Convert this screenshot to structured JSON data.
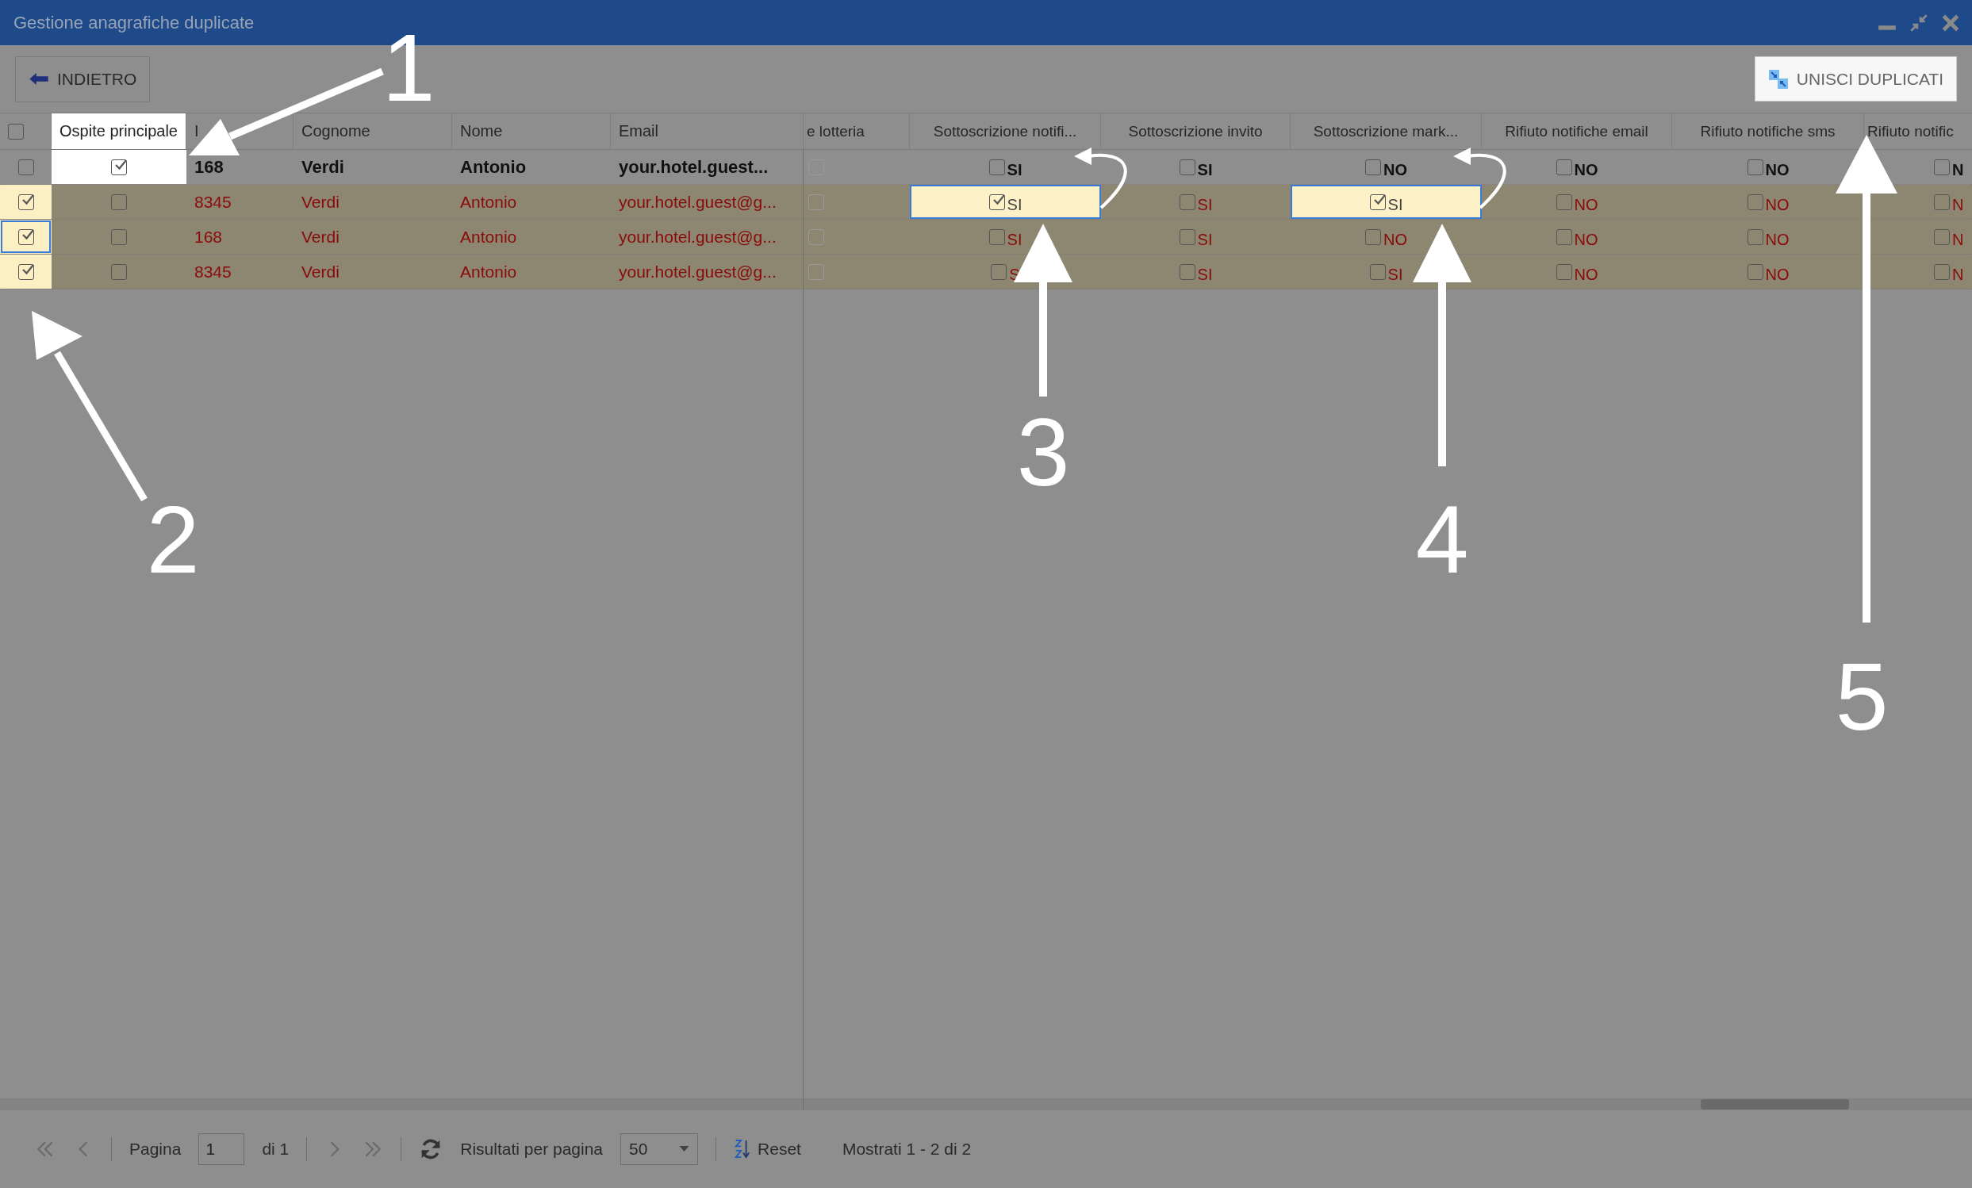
{
  "window": {
    "title": "Gestione anagrafiche duplicate"
  },
  "toolbar": {
    "back_button": "INDIETRO",
    "merge_button": "UNISCI DUPLICATI"
  },
  "table": {
    "select_all": {
      "checked": false
    },
    "left_columns": [
      {
        "label": "Ospite principale",
        "spotlight": true
      },
      {
        "label": "I",
        "spotlight": false
      },
      {
        "label": "Cognome",
        "spotlight": false
      },
      {
        "label": "Nome",
        "spotlight": false
      },
      {
        "label": "Email",
        "spotlight": false
      }
    ],
    "right_columns": [
      "e lotteria",
      "Sottoscrizione notifi...",
      "Sottoscrizione invito",
      "Sottoscrizione mark...",
      "Rifiuto notifiche email",
      "Rifiuto notifiche sms",
      "Rifiuto notific"
    ],
    "rows": [
      {
        "kind": "main",
        "selected": false,
        "focused": false,
        "primary": true,
        "primary_spotlight": true,
        "id": "168",
        "surname": "Verdi",
        "name": "Antonio",
        "email": "your.hotel.guest...",
        "lottery": {
          "checked": false
        },
        "flags": [
          {
            "checked": false,
            "value": "SI",
            "highlighted": false
          },
          {
            "checked": false,
            "value": "SI",
            "highlighted": false
          },
          {
            "checked": false,
            "value": "NO",
            "highlighted": false
          },
          {
            "checked": false,
            "value": "NO",
            "highlighted": false
          },
          {
            "checked": false,
            "value": "NO",
            "highlighted": false
          },
          {
            "checked": false,
            "value": "N",
            "highlighted": false
          }
        ]
      },
      {
        "kind": "duplicate",
        "selected": true,
        "focused": false,
        "primary": false,
        "primary_spotlight": false,
        "id": "8345",
        "surname": "Verdi",
        "name": "Antonio",
        "email": "your.hotel.guest@g...",
        "lottery": {
          "checked": false
        },
        "flags": [
          {
            "checked": true,
            "value": "SI",
            "highlighted": true
          },
          {
            "checked": false,
            "value": "SI",
            "highlighted": false
          },
          {
            "checked": true,
            "value": "SI",
            "highlighted": true
          },
          {
            "checked": false,
            "value": "NO",
            "highlighted": false
          },
          {
            "checked": false,
            "value": "NO",
            "highlighted": false
          },
          {
            "checked": false,
            "value": "N",
            "highlighted": false
          }
        ]
      },
      {
        "kind": "duplicate",
        "selected": true,
        "focused": true,
        "primary": false,
        "primary_spotlight": false,
        "id": "168",
        "surname": "Verdi",
        "name": "Antonio",
        "email": "your.hotel.guest@g...",
        "lottery": {
          "checked": false
        },
        "flags": [
          {
            "checked": false,
            "value": "SI",
            "highlighted": false
          },
          {
            "checked": false,
            "value": "SI",
            "highlighted": false
          },
          {
            "checked": false,
            "value": "NO",
            "highlighted": false
          },
          {
            "checked": false,
            "value": "NO",
            "highlighted": false
          },
          {
            "checked": false,
            "value": "NO",
            "highlighted": false
          },
          {
            "checked": false,
            "value": "N",
            "highlighted": false
          }
        ]
      },
      {
        "kind": "duplicate",
        "selected": true,
        "focused": false,
        "primary": false,
        "primary_spotlight": false,
        "id": "8345",
        "surname": "Verdi",
        "name": "Antonio",
        "email": "your.hotel.guest@g...",
        "lottery": {
          "checked": false
        },
        "flags": [
          {
            "checked": false,
            "value": "S",
            "highlighted": false
          },
          {
            "checked": false,
            "value": "SI",
            "highlighted": false
          },
          {
            "checked": false,
            "value": "SI",
            "highlighted": false
          },
          {
            "checked": false,
            "value": "NO",
            "highlighted": false
          },
          {
            "checked": false,
            "value": "NO",
            "highlighted": false
          },
          {
            "checked": false,
            "value": "N",
            "highlighted": false
          }
        ]
      }
    ]
  },
  "pagination": {
    "page_label": "Pagina",
    "page": "1",
    "of": "di 1",
    "per_page_label": "Risultati per pagina",
    "per_page": "50",
    "reset": "Reset",
    "summary": "Mostrati 1 - 2 di 2"
  },
  "annotations": [
    {
      "label": "1"
    },
    {
      "label": "2"
    },
    {
      "label": "3"
    },
    {
      "label": "4"
    },
    {
      "label": "5"
    }
  ]
}
